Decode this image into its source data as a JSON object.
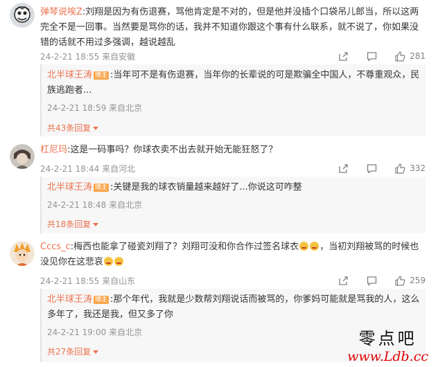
{
  "comments": [
    {
      "username": "弹琴说唉Z",
      "text": ":刘翔是因为有伤退赛，骂他肯定是不对的，但是他并没插个口袋吊儿郎当，所以这两完全不是一回事。当然要是骂你的话，我并不知道你跟这个事有什么联系，就不说了，你如果没错的话就不用过多强调，越说越乱",
      "time": "24-2-21 18:55",
      "location": "来自安徽",
      "likes": "281",
      "reply": {
        "username": "北半球王涛",
        "badge": "博主",
        "text": ":当年可不是有伤退赛，当年你的长辈说的可是欺骗全中国人，不尊重观众，民族逃跑者...",
        "time": "24-2-21 18:59",
        "location": "来自北京"
      },
      "more_replies": "共43条回复"
    },
    {
      "username": "杠尼玛",
      "text": ":这是一码事吗？你球衣卖不出去就开始无能狂怒了？",
      "time": "24-2-21 18:44",
      "location": "来自河北",
      "likes": "332",
      "reply": {
        "username": "北半球王涛",
        "badge": "博主",
        "text": ":关键是我的球衣销量越来越好了...你说这可咋整",
        "time": "24-2-21 18:48",
        "location": "来自北京"
      },
      "more_replies": "共18条回复"
    },
    {
      "username": "Cccs_c",
      "text_a": ":梅西也能拿了碰瓷刘翔了？刘翔可没和你合作过签名球衣",
      "text_b": "，当初刘翔被骂的时候也没见你在这悲哀",
      "time": "24-2-21 18:55",
      "location": "来自山东",
      "likes": "259",
      "reply": {
        "username": "北半球王涛",
        "badge": "博主",
        "text": ":那个年代，我就是少数帮刘翔说话而被骂的，你爹妈可能就是骂我的人，这么多年了，我还是我，但又多了你",
        "time": "24-2-21 19:00",
        "location": "来自北京"
      },
      "more_replies": "共27条回复"
    }
  ],
  "watermark": {
    "title": "零点吧",
    "url": "www.Ldb.cc"
  },
  "icons": [
    "share-icon",
    "comment-icon",
    "like-icon",
    "emoji-icon"
  ],
  "colors": {
    "username": "#eb7350",
    "badge": "#f8a54b",
    "meta": "#939393",
    "reply_bg": "#f7f7f7",
    "watermark_url": "#e00000"
  }
}
